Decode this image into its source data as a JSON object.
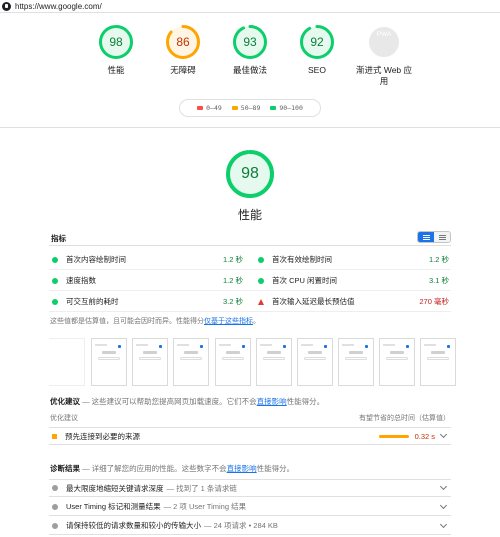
{
  "browser": {
    "url": "https://www.google.com/"
  },
  "categories": [
    {
      "label": "性能",
      "score": "98",
      "value": 0.98,
      "color": "#0cce6b",
      "bg": "#e5f9ee",
      "text": "#0c7d38"
    },
    {
      "label": "无障碍",
      "score": "86",
      "value": 0.86,
      "color": "#ffa400",
      "bg": "#fff5e5",
      "text": "#c33300"
    },
    {
      "label": "最佳做法",
      "score": "93",
      "value": 0.93,
      "color": "#0cce6b",
      "bg": "#e5f9ee",
      "text": "#0c7d38"
    },
    {
      "label": "SEO",
      "score": "92",
      "value": 0.92,
      "color": "#0cce6b",
      "bg": "#e5f9ee",
      "text": "#0c7d38"
    },
    {
      "label": "渐进式 Web 应用",
      "score": "PWA",
      "value": 0,
      "color": "#e0e0e0",
      "bg": "#e8e8e8",
      "text": "#ffffff"
    }
  ],
  "legend": [
    {
      "label": "0–49",
      "color": "#ff4e42"
    },
    {
      "label": "50–89",
      "color": "#ffa400"
    },
    {
      "label": "90–100",
      "color": "#0cce6b"
    }
  ],
  "performance": {
    "score": "98",
    "value": 0.98,
    "label": "性能"
  },
  "metrics": {
    "title": "指标",
    "rows": [
      {
        "left": {
          "name": "首次内容绘制时间",
          "value": "1.2 秒",
          "status": "good"
        },
        "right": {
          "name": "首次有效绘制时间",
          "value": "1.2 秒",
          "status": "good"
        }
      },
      {
        "left": {
          "name": "速度指数",
          "value": "1.2 秒",
          "status": "good"
        },
        "right": {
          "name": "首次 CPU 闲置时间",
          "value": "3.1 秒",
          "status": "good"
        }
      },
      {
        "left": {
          "name": "可交互前的耗时",
          "value": "3.2 秒",
          "status": "good"
        },
        "right": {
          "name": "首次输入延迟最长预估值",
          "value": "270 毫秒",
          "status": "bad"
        }
      }
    ]
  },
  "note": {
    "text": "这些值都是估算值，且可能会因时而异。性能得分",
    "link": "仅基于这些指标",
    "end": "。"
  },
  "opportunities": {
    "title": "优化建议",
    "desc": " — 这些建议可以帮助您提高网页加载速度。它们不会",
    "link": "直接影响",
    "desc_end": "性能得分。",
    "col_left": "优化建议",
    "col_right": "有望节省的总时间（估算值）",
    "items": [
      {
        "name": "预先连接到必要的来源",
        "value": "0.32 s"
      }
    ]
  },
  "diagnostics": {
    "title": "诊断结果",
    "desc": " — 详细了解您的应用的性能。这些数字不会",
    "link": "直接影响",
    "desc_end": "性能得分。",
    "items": [
      {
        "name": "最大限度地缩短关键请求深度",
        "extra": "— 找到了 1 条请求链"
      },
      {
        "name": "User Timing 标记和测量结果",
        "extra": "— 2 项 User Timing 结果"
      },
      {
        "name": "请保持较低的请求数量和较小的传输大小",
        "extra": "— 24 项请求 • 284 KB"
      }
    ]
  }
}
